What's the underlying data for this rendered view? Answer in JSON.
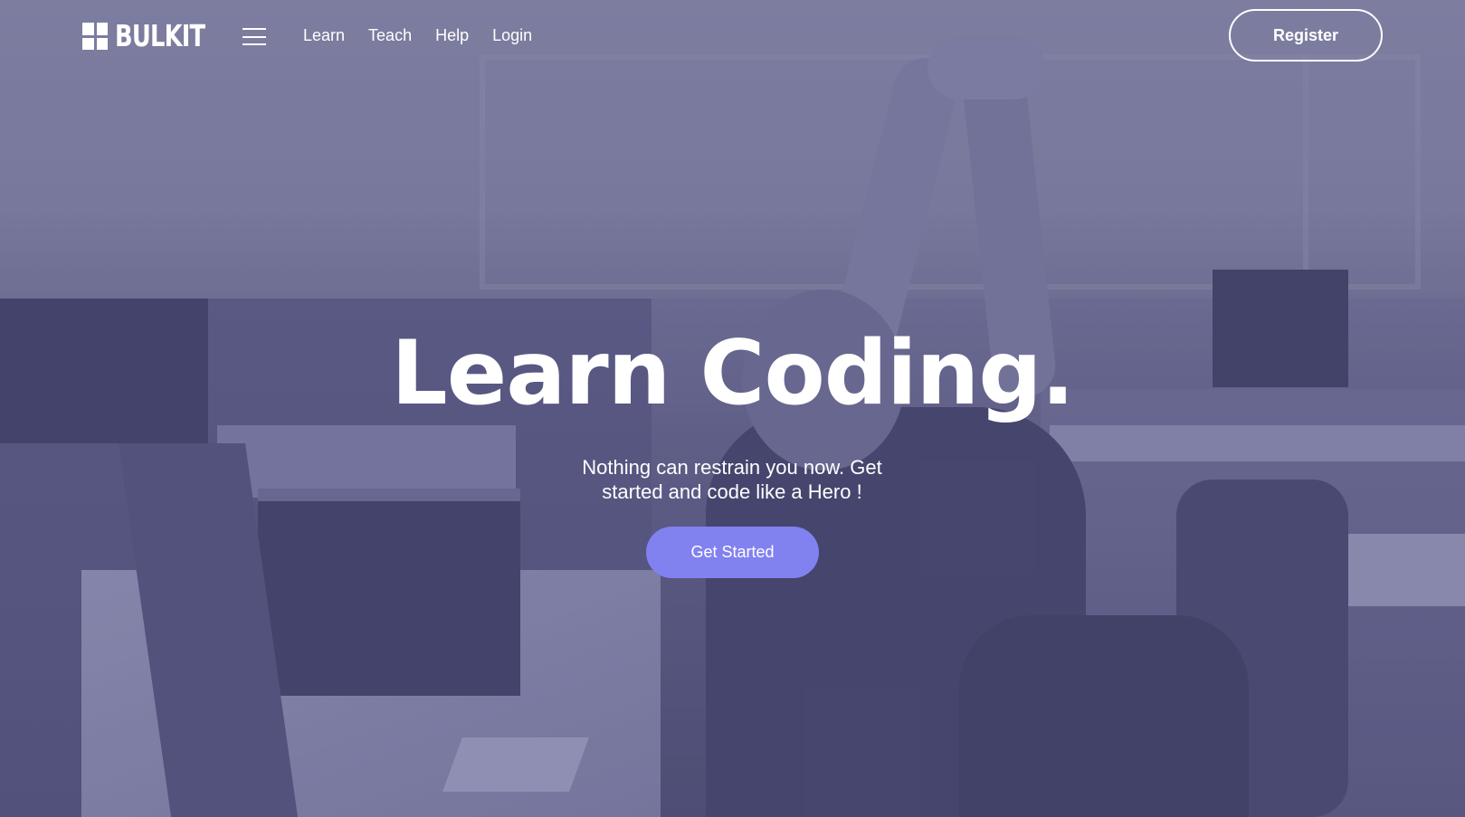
{
  "brand": {
    "name": "BULKIT",
    "logo_icon": "grid-squares-icon"
  },
  "nav": {
    "menu_icon": "hamburger-menu-icon",
    "links": [
      "Learn",
      "Teach",
      "Help",
      "Login"
    ],
    "register_label": "Register"
  },
  "hero": {
    "title": "Learn Coding.",
    "subtitle": "Nothing can restrain you now. Get started and code like a Hero !",
    "cta_label": "Get Started",
    "background_image": "office-worker-stretching-photo"
  },
  "colors": {
    "overlay": "#6f6f95",
    "cta_background": "#8181f0",
    "text": "#ffffff"
  }
}
